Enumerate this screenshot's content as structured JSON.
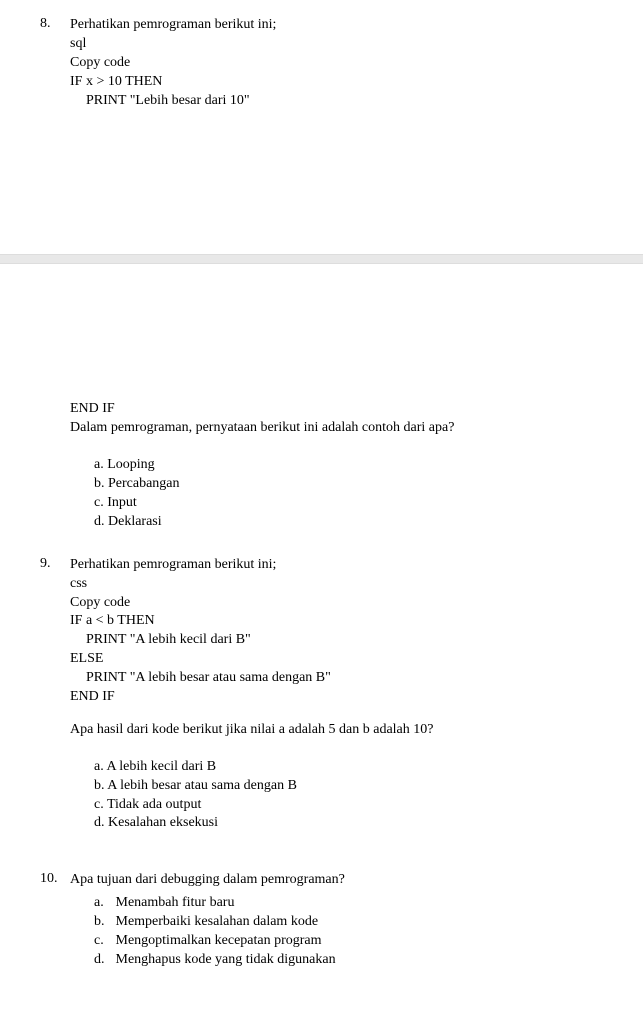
{
  "q8": {
    "number": "8.",
    "intro": "Perhatikan pemrograman berikut ini;",
    "lang": "sql",
    "copy": "Copy code",
    "code1": "IF x > 10 THEN",
    "code2": "PRINT \"Lebih besar dari 10\"",
    "code3": "END IF",
    "prompt": "Dalam pemrograman, pernyataan berikut ini adalah contoh dari apa?",
    "options": {
      "a": "a. Looping",
      "b": "b. Percabangan",
      "c": "c. Input",
      "d": "d. Deklarasi"
    }
  },
  "q9": {
    "number": "9.",
    "intro": "Perhatikan pemrograman berikut ini;",
    "lang": "css",
    "copy": "Copy code",
    "code1": "IF a < b THEN",
    "code2": "PRINT \"A lebih kecil dari B\"",
    "code3": "ELSE",
    "code4": "PRINT \"A lebih besar atau sama dengan B\"",
    "code5": "END IF",
    "prompt": "Apa hasil dari kode berikut jika nilai a adalah 5 dan b adalah 10?",
    "options": {
      "a": "a. A lebih kecil dari B",
      "b": "b. A lebih besar atau sama dengan B",
      "c": "c. Tidak ada output",
      "d": "d. Kesalahan eksekusi"
    }
  },
  "q10": {
    "number": "10.",
    "prompt": "Apa tujuan dari debugging dalam pemrograman?",
    "options": {
      "a_letter": "a.",
      "a_text": "Menambah fitur baru",
      "b_letter": "b.",
      "b_text": "Memperbaiki kesalahan dalam kode",
      "c_letter": "c.",
      "c_text": "Mengoptimalkan kecepatan program",
      "d_letter": "d.",
      "d_text": "Menghapus kode yang tidak digunakan"
    }
  }
}
